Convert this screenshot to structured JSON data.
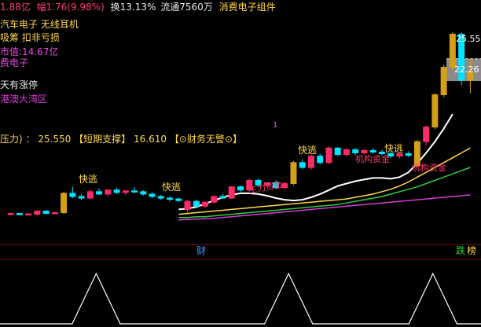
{
  "header": {
    "line1_a": "1.88亿",
    "line1_b": "幅1.76(9.98%)",
    "line1_c": "换13.13%",
    "line1_d": "流通7560万",
    "line1_e": "消费电子组件"
  },
  "info": {
    "name": "汽车电子  无线耳机",
    "tag": "吸筹  扣非亏损",
    "mcap": "市值:14.67亿",
    "sector": "费电子",
    "limit": "天有涨停",
    "region": "港澳大湾区"
  },
  "pressure": {
    "label": "压力) ：",
    "pressure_value": "25.550",
    "support_label": "【短期支撑】",
    "support_value": "16.610",
    "warn": "【⊙财务无警⊙】"
  },
  "annotations": {
    "fast_escape": "快逃",
    "main_fund": "主力资金",
    "main_fund2": "机构资金",
    "tag1": "1",
    "price_high": "25.55",
    "price_mark": "22.26",
    "cai": "财",
    "die": "跌",
    "bang": "榜"
  },
  "colors": {
    "up": "#ff2a6a",
    "down": "#00e5ff",
    "gold": "#d4a017",
    "yellow": "#ffd84a",
    "green": "#2ecc40",
    "magenta": "#d63cd6",
    "white": "#ffffff"
  },
  "chart_data": {
    "type": "candlestick",
    "candles": [
      {
        "o": 3.0,
        "h": 3.2,
        "l": 2.9,
        "c": 3.1
      },
      {
        "o": 3.1,
        "h": 3.2,
        "l": 2.9,
        "c": 2.95
      },
      {
        "o": 2.95,
        "h": 3.1,
        "l": 2.9,
        "c": 3.05
      },
      {
        "o": 3.0,
        "h": 3.5,
        "l": 2.8,
        "c": 3.4
      },
      {
        "o": 3.4,
        "h": 3.5,
        "l": 3.0,
        "c": 3.1
      },
      {
        "o": 3.1,
        "h": 3.3,
        "l": 3.0,
        "c": 3.2
      },
      {
        "o": 3.2,
        "h": 5.8,
        "l": 3.0,
        "c": 5.6
      },
      {
        "o": 5.6,
        "h": 6.4,
        "l": 5.0,
        "c": 5.2
      },
      {
        "o": 5.2,
        "h": 5.5,
        "l": 4.8,
        "c": 5.0
      },
      {
        "o": 5.0,
        "h": 6.0,
        "l": 4.8,
        "c": 5.8
      },
      {
        "o": 5.8,
        "h": 6.2,
        "l": 5.4,
        "c": 5.5
      },
      {
        "o": 5.5,
        "h": 6.1,
        "l": 5.2,
        "c": 6.0
      },
      {
        "o": 6.0,
        "h": 6.3,
        "l": 5.5,
        "c": 5.7
      },
      {
        "o": 5.7,
        "h": 6.0,
        "l": 5.4,
        "c": 5.9
      },
      {
        "o": 5.9,
        "h": 6.4,
        "l": 5.6,
        "c": 5.8
      },
      {
        "o": 5.8,
        "h": 6.0,
        "l": 5.3,
        "c": 5.5
      },
      {
        "o": 5.5,
        "h": 5.7,
        "l": 5.0,
        "c": 5.2
      },
      {
        "o": 5.2,
        "h": 5.4,
        "l": 4.8,
        "c": 5.0
      },
      {
        "o": 5.0,
        "h": 5.2,
        "l": 4.6,
        "c": 4.9
      },
      {
        "o": 4.9,
        "h": 5.1,
        "l": 4.5,
        "c": 4.7
      },
      {
        "o": 3.6,
        "h": 4.8,
        "l": 3.2,
        "c": 4.6
      },
      {
        "o": 4.6,
        "h": 4.8,
        "l": 3.9,
        "c": 4.0
      },
      {
        "o": 4.0,
        "h": 4.6,
        "l": 3.8,
        "c": 4.5
      },
      {
        "o": 4.5,
        "h": 5.4,
        "l": 4.3,
        "c": 5.2
      },
      {
        "o": 5.2,
        "h": 5.5,
        "l": 4.9,
        "c": 5.0
      },
      {
        "o": 5.0,
        "h": 6.5,
        "l": 4.9,
        "c": 6.4
      },
      {
        "o": 6.4,
        "h": 6.6,
        "l": 5.8,
        "c": 6.0
      },
      {
        "o": 6.0,
        "h": 7.4,
        "l": 5.8,
        "c": 7.2
      },
      {
        "o": 7.2,
        "h": 7.4,
        "l": 6.5,
        "c": 6.6
      },
      {
        "o": 6.6,
        "h": 7.0,
        "l": 6.4,
        "c": 6.9
      },
      {
        "o": 6.9,
        "h": 7.2,
        "l": 6.2,
        "c": 6.3
      },
      {
        "o": 6.3,
        "h": 7.0,
        "l": 6.1,
        "c": 6.8
      },
      {
        "o": 6.8,
        "h": 9.6,
        "l": 6.6,
        "c": 9.4
      },
      {
        "o": 9.4,
        "h": 9.8,
        "l": 8.6,
        "c": 8.8
      },
      {
        "o": 8.8,
        "h": 10.4,
        "l": 8.5,
        "c": 10.2
      },
      {
        "o": 10.2,
        "h": 10.5,
        "l": 9.2,
        "c": 9.4
      },
      {
        "o": 9.4,
        "h": 11.4,
        "l": 9.2,
        "c": 11.2
      },
      {
        "o": 11.2,
        "h": 11.3,
        "l": 10.2,
        "c": 10.4
      },
      {
        "o": 10.4,
        "h": 11.2,
        "l": 10.1,
        "c": 11.0
      },
      {
        "o": 11.0,
        "h": 11.2,
        "l": 10.3,
        "c": 10.6
      },
      {
        "o": 10.6,
        "h": 11.1,
        "l": 10.4,
        "c": 10.9
      },
      {
        "o": 10.9,
        "h": 11.2,
        "l": 10.5,
        "c": 10.7
      },
      {
        "o": 10.7,
        "h": 11.0,
        "l": 10.3,
        "c": 10.5
      },
      {
        "o": 10.5,
        "h": 10.8,
        "l": 10.0,
        "c": 10.2
      },
      {
        "o": 10.2,
        "h": 10.6,
        "l": 9.9,
        "c": 10.5
      },
      {
        "o": 10.5,
        "h": 10.8,
        "l": 10.1,
        "c": 10.3
      },
      {
        "o": 9.0,
        "h": 12.2,
        "l": 8.8,
        "c": 12.0
      },
      {
        "o": 12.0,
        "h": 14.0,
        "l": 11.5,
        "c": 13.8
      },
      {
        "o": 13.8,
        "h": 18.0,
        "l": 13.5,
        "c": 17.8
      },
      {
        "o": 17.8,
        "h": 21.5,
        "l": 17.5,
        "c": 21.2
      },
      {
        "o": 21.2,
        "h": 25.55,
        "l": 20.8,
        "c": 25.3
      },
      {
        "o": 25.3,
        "h": 25.5,
        "l": 19.0,
        "c": 19.6
      },
      {
        "o": 19.6,
        "h": 22.3,
        "l": 18.0,
        "c": 20.6
      }
    ],
    "ma_white": [
      3.6,
      3.7,
      3.9,
      4.3,
      4.7,
      5.1,
      5.4,
      5.6,
      5.6,
      5.5,
      5.3,
      5.0,
      4.8,
      4.7,
      4.8,
      5.1,
      5.5,
      6.0,
      6.5,
      6.8,
      7.1,
      7.3,
      7.5,
      7.5,
      7.4,
      7.6,
      8.2,
      9.3,
      10.6,
      12.0,
      13.6,
      15.4
    ],
    "ma_yellow": [
      3.0,
      3.1,
      3.2,
      3.3,
      3.4,
      3.5,
      3.6,
      3.7,
      3.8,
      3.9,
      4.0,
      4.1,
      4.2,
      4.3,
      4.4,
      4.5,
      4.6,
      4.7,
      4.8,
      4.9,
      5.1,
      5.3,
      5.5,
      5.8,
      6.1,
      6.5,
      7.0,
      7.6,
      8.2,
      8.8,
      9.4,
      10.0,
      10.6,
      11.2
    ],
    "ma_green": [
      2.6,
      2.6,
      2.7,
      2.7,
      2.8,
      2.9,
      3.0,
      3.1,
      3.2,
      3.3,
      3.4,
      3.5,
      3.6,
      3.7,
      3.8,
      3.9,
      4.0,
      4.1,
      4.2,
      4.4,
      4.6,
      4.8,
      5.0,
      5.2,
      5.5,
      5.8,
      6.1,
      6.4,
      6.8,
      7.2,
      7.6,
      8.0,
      8.4,
      8.8
    ],
    "ma_magenta": [
      2.3,
      2.35,
      2.4,
      2.45,
      2.5,
      2.6,
      2.7,
      2.8,
      2.9,
      3.0,
      3.1,
      3.2,
      3.3,
      3.4,
      3.5,
      3.6,
      3.7,
      3.8,
      3.9,
      4.0,
      4.1,
      4.2,
      4.3,
      4.4,
      4.5,
      4.6,
      4.7,
      4.8,
      4.9,
      5.0,
      5.1,
      5.2,
      5.3,
      5.4
    ],
    "ylim": [
      1.5,
      27
    ],
    "indicator": [
      0,
      0,
      0,
      0,
      1,
      0,
      0,
      0,
      0,
      0,
      0,
      0,
      1,
      0,
      0,
      0,
      0,
      0,
      1,
      0,
      0
    ]
  }
}
